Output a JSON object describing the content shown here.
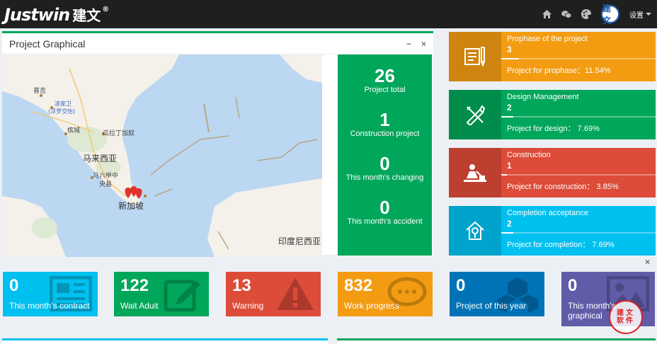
{
  "header": {
    "logo_text": "Justwin",
    "logo_cn": "建文",
    "logo_mark": "®",
    "avatar_text": "建文",
    "settings_label": "设置",
    "icons": [
      "home-icon",
      "wechat-icon",
      "palette-icon"
    ]
  },
  "map_panel": {
    "title": "Project Graphical",
    "minimize": "−",
    "close": "×",
    "labels": {
      "putri": "普吉",
      "kangkar": "凌家卫",
      "kangkar2": "(浮罗交怡)",
      "penang": "槟城",
      "kuala_tg": "瓜拉丁加奴",
      "malaysia": "马来西亚",
      "malacca": "马六甲中",
      "malacca2": "央县",
      "singapore": "新加坡",
      "indonesia": "印度尼西亚"
    }
  },
  "stats": [
    {
      "value": "26",
      "label": "Project total"
    },
    {
      "value": "1",
      "label": "Construction project"
    },
    {
      "value": "0",
      "label": "This month's changing"
    },
    {
      "value": "0",
      "label": "This month's accident"
    }
  ],
  "info_boxes": [
    {
      "title": "Prophase of the project",
      "value": "3",
      "desc": "Project for prophase：11.54%",
      "progress": 0.1154,
      "color": "#f39c12",
      "icon": "document-pen-icon"
    },
    {
      "title": "Design Management",
      "value": "2",
      "desc": "Project for design： 7.69%",
      "progress": 0.0769,
      "color": "#00a65a",
      "icon": "ruler-pencil-icon"
    },
    {
      "title": "Construction",
      "value": "1",
      "desc": "Project for construction： 3.85%",
      "progress": 0.0385,
      "color": "#dd4b39",
      "icon": "worker-icon"
    },
    {
      "title": "Completion acceptance",
      "value": "2",
      "desc": "Project for completion： 7.69%",
      "progress": 0.0769,
      "color": "#00c0ef",
      "icon": "house-check-icon"
    }
  ],
  "small_boxes": [
    {
      "value": "0",
      "label": "This month's contract",
      "color": "#00c0ef",
      "icon": "newspaper-icon"
    },
    {
      "value": "122",
      "label": "Wait Aduit",
      "color": "#00a65a",
      "icon": "edit-icon"
    },
    {
      "value": "13",
      "label": "Warning",
      "color": "#dd4b39",
      "icon": "warning-icon"
    },
    {
      "value": "832",
      "label": "Work progress",
      "color": "#f39c12",
      "icon": "chat-icon"
    },
    {
      "value": "0",
      "label": "Project of this year",
      "color": "#0073b7",
      "icon": "cubes-icon"
    },
    {
      "value": "0",
      "label": "This month's graphical",
      "color": "#605ca8",
      "icon": "image-icon"
    }
  ],
  "close_mark": "×",
  "stamp_text": "建文软件"
}
